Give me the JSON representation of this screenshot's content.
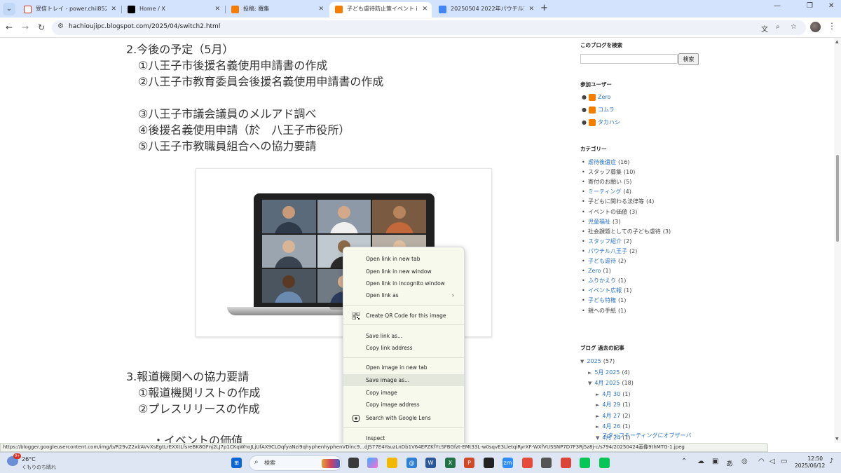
{
  "browser": {
    "tabs": [
      {
        "title": "受信トレイ - power.chil852@gm",
        "icon": "gmail-icon",
        "color": "#d93025",
        "active": false
      },
      {
        "title": "Home / X",
        "icon": "x-logo-icon",
        "color": "#000000",
        "active": false
      },
      {
        "title": "投稿: 羅集",
        "icon": "blogger-icon",
        "color": "#f57d00",
        "active": false
      },
      {
        "title": "子ども虐待防止策イベント in 八王",
        "icon": "blogger-icon",
        "color": "#f57d00",
        "active": true
      },
      {
        "title": "20250504 2022年パウチル東京で",
        "icon": "docs-icon",
        "color": "#4285f4",
        "active": false
      }
    ],
    "url": "hachioujipc.blogspot.com/2025/04/switch2.html"
  },
  "post": {
    "lines": [
      "2.今後の予定（5月）",
      "①八王子市後援名義使用申請書の作成",
      "②八王子市教育委員会後援名義使用申請書の作成",
      "③八王子市議会議員のメルアド調べ",
      "④後援名義使用申請（於　八王子市役所）",
      "⑤八王子市教職員組合への協力要請",
      "3.報道機関への協力要請",
      "①報道機関リストの作成",
      "②プレスリリースの作成",
      "・イベントの価値"
    ]
  },
  "sidebar": {
    "search_title": "このブログを検索",
    "search_button": "検索",
    "members_title": "参加ユーザー",
    "members": [
      "Zero",
      "コムラ",
      "タカハシ"
    ],
    "categories_title": "カテゴリー",
    "categories": [
      {
        "name": "虐待後遺症",
        "count": "(16)",
        "link": true
      },
      {
        "name": "スタッフ募集",
        "count": "(10)",
        "link": false
      },
      {
        "name": "寄付のお願い",
        "count": "(5)",
        "link": false
      },
      {
        "name": "ミーティング",
        "count": "(4)",
        "link": true
      },
      {
        "name": "子どもに関わる法律等",
        "count": "(4)",
        "link": false
      },
      {
        "name": "イベントの価値",
        "count": "(3)",
        "link": false
      },
      {
        "name": "児童福祉",
        "count": "(3)",
        "link": true
      },
      {
        "name": "社会課題としての子ども虐待",
        "count": "(3)",
        "link": false
      },
      {
        "name": "スタッフ紹介",
        "count": "(2)",
        "link": true
      },
      {
        "name": "パウチル八王子",
        "count": "(2)",
        "link": true
      },
      {
        "name": "子ども虐待",
        "count": "(2)",
        "link": true
      },
      {
        "name": "Zero",
        "count": "(1)",
        "link": true
      },
      {
        "name": "ふりかえり",
        "count": "(1)",
        "link": true
      },
      {
        "name": "イベント広報",
        "count": "(1)",
        "link": true
      },
      {
        "name": "子ども特権",
        "count": "(1)",
        "link": true
      },
      {
        "name": "親への手紙",
        "count": "(1)",
        "link": false
      }
    ],
    "archive_title": "ブログ 過去の記事",
    "archive": [
      {
        "level": 0,
        "arrow": "▼",
        "label": "2025",
        "count": "(57)"
      },
      {
        "level": 1,
        "arrow": "►",
        "label": "5月 2025",
        "count": "(4)"
      },
      {
        "level": 1,
        "arrow": "▼",
        "label": "4月 2025",
        "count": "(18)"
      },
      {
        "level": 2,
        "arrow": "►",
        "label": "4月 30",
        "count": "(1)"
      },
      {
        "level": 2,
        "arrow": "►",
        "label": "4月 29",
        "count": "(1)"
      },
      {
        "level": 2,
        "arrow": "►",
        "label": "4月 27",
        "count": "(2)"
      },
      {
        "level": 2,
        "arrow": "►",
        "label": "4月 26",
        "count": "(1)"
      },
      {
        "level": 2,
        "arrow": "▼",
        "label": "4月 24",
        "count": "(1)"
      }
    ],
    "archive_post": "スタッフミーティングにオブザーバ"
  },
  "context_menu": {
    "items": [
      "Open link in new tab",
      "Open link in new window",
      "Open link in incognito window",
      "Open link as",
      "Create QR Code for this image",
      "Save link as...",
      "Copy link address",
      "Open image in new tab",
      "Save image as...",
      "Copy image",
      "Copy image address",
      "Search with Google Lens",
      "Inspect"
    ],
    "highlighted": "Save image as..."
  },
  "status_url": "https://blogger.googleusercontent.com/img/b/R29vZ2xl/AVvXsEgtLrEXXtLfsreBK8GFnj2LJ7p1CKqWhoJLjUfAX9CLOqfyaNzi9qhyphenhyphenVDlnc9...dJS77E4YauzLnDb1V64EPZKfYcSFBGfzt-EMt33L-w0sqvE3LletqiRyrXF-WXfVUSSNP7D7F3Rj5z8j-c/s794/20250424画像9thMTG-1.jpeg",
  "taskbar": {
    "temp": "26°C",
    "weather": "くもりのち晴れ",
    "weather_badge": "9+",
    "search_placeholder": "検索",
    "ime": "あ",
    "time": "12:50",
    "date": "2025/06/12"
  }
}
